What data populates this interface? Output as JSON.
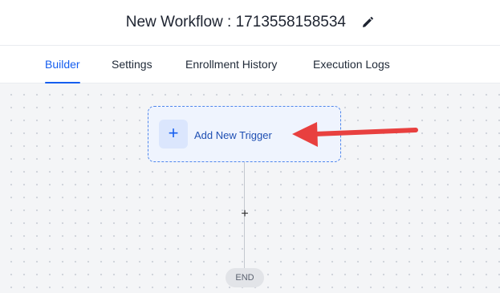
{
  "header": {
    "title": "New Workflow : 1713558158534",
    "edit_icon": "pencil-icon"
  },
  "tabs": [
    {
      "label": "Builder",
      "active": true
    },
    {
      "label": "Settings",
      "active": false
    },
    {
      "label": "Enrollment History",
      "active": false
    },
    {
      "label": "Execution Logs",
      "active": false
    }
  ],
  "canvas": {
    "trigger": {
      "icon": "plus",
      "label": "Add New Trigger"
    },
    "add_step_icon": "+",
    "end_label": "END"
  },
  "annotation": {
    "arrow_color": "#e8403f",
    "points_to": "Add New Trigger"
  },
  "colors": {
    "accent": "#155eef",
    "trigger_border": "#4f86ec"
  }
}
